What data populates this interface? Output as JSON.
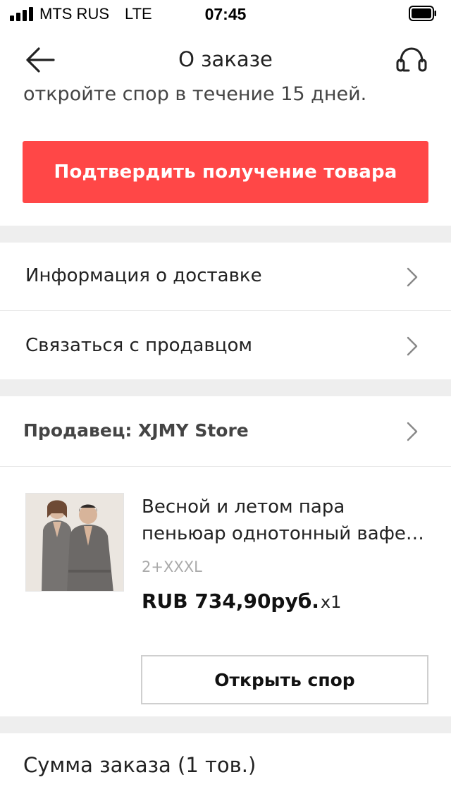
{
  "status_bar": {
    "carrier": "MTS RUS",
    "network": "LTE",
    "time": "07:45"
  },
  "header": {
    "title": "О заказе",
    "back_icon": "arrow-left-icon",
    "support_icon": "headset-icon"
  },
  "notice_text": "откройте спор в течение 15 дней.",
  "confirm_button": "Подтвердить получение товара",
  "menu_items": [
    {
      "label": "Информация о доставке"
    },
    {
      "label": "Связаться с продавцом"
    }
  ],
  "seller": {
    "label": "Продавец: XJMY Store"
  },
  "product": {
    "title_line1": "Весной и летом пара",
    "title_line2": "пеньюар однотонный вафе…",
    "variant": "2+XXXL",
    "price": "RUB 734,90руб.",
    "quantity": "x1"
  },
  "dispute_button": "Открыть спор",
  "order_summary": {
    "label": "Сумма заказа (1 тов.)"
  },
  "colors": {
    "accent": "#ff4747",
    "separator": "#eeeeee"
  }
}
